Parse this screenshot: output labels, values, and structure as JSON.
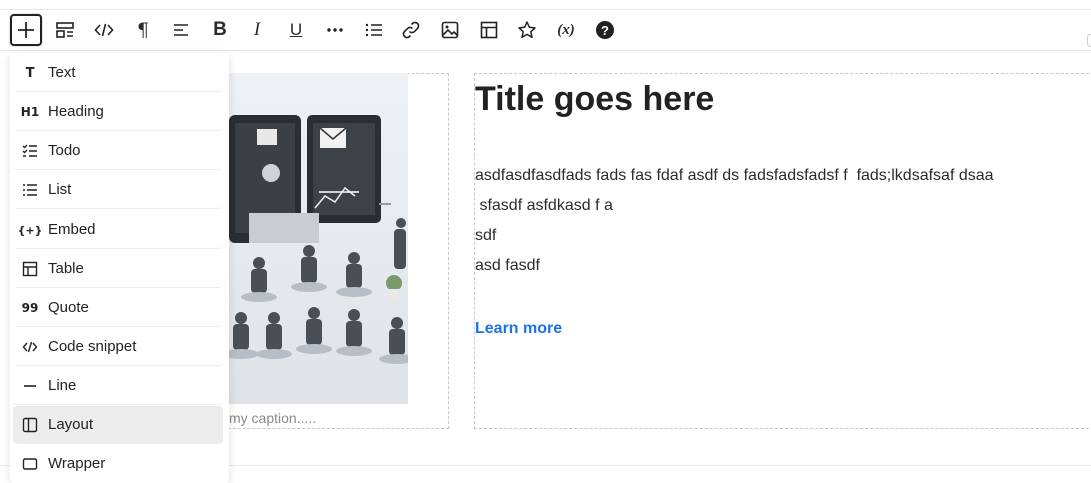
{
  "toolbar": {
    "buttons": [
      {
        "icon": "plus-icon"
      },
      {
        "icon": "layout-blocks-icon"
      },
      {
        "icon": "code-icon"
      },
      {
        "icon": "paragraph-icon"
      },
      {
        "icon": "align-left-icon"
      },
      {
        "icon": "bold-icon"
      },
      {
        "icon": "italic-icon"
      },
      {
        "icon": "underline-icon"
      },
      {
        "icon": "more-icon"
      },
      {
        "icon": "list-icon"
      },
      {
        "icon": "link-icon"
      },
      {
        "icon": "image-icon"
      },
      {
        "icon": "table-icon"
      },
      {
        "icon": "star-icon"
      },
      {
        "icon": "variable-icon"
      },
      {
        "icon": "help-icon"
      }
    ],
    "paragraph_glyph": "¶",
    "bold_glyph": "B",
    "italic_glyph": "I",
    "underline_glyph": "U",
    "variable_glyph": "(x)",
    "help_glyph": "?"
  },
  "insert_menu": {
    "items": [
      {
        "label": "Text",
        "icon": "text-icon",
        "glyph": "T"
      },
      {
        "label": "Heading",
        "icon": "heading-icon",
        "glyph": "H1"
      },
      {
        "label": "Todo",
        "icon": "todo-icon"
      },
      {
        "label": "List",
        "icon": "list-icon"
      },
      {
        "label": "Embed",
        "icon": "embed-icon",
        "glyph": "{+}"
      },
      {
        "label": "Table",
        "icon": "table-icon"
      },
      {
        "label": "Quote",
        "icon": "quote-icon",
        "glyph": "99"
      },
      {
        "label": "Code snippet",
        "icon": "code-icon"
      },
      {
        "label": "Line",
        "icon": "line-icon"
      },
      {
        "label": "Layout",
        "icon": "layout-icon",
        "active": true
      },
      {
        "label": "Wrapper",
        "icon": "wrapper-icon"
      }
    ]
  },
  "content": {
    "image_caption": "my caption.....",
    "title": "Title goes here",
    "paragraphs": [
      "asdfasdfasdfads fads fas fdaf asdf ds fadsfadsfadsf f  fads;lkdsafsaf dsaa",
      " sfasdf asfdkasd f a",
      "sdf",
      "asd fasdf"
    ],
    "link_label": "Learn more"
  },
  "colors": {
    "accent": "#1a73e8",
    "active_item": "#ececec"
  }
}
